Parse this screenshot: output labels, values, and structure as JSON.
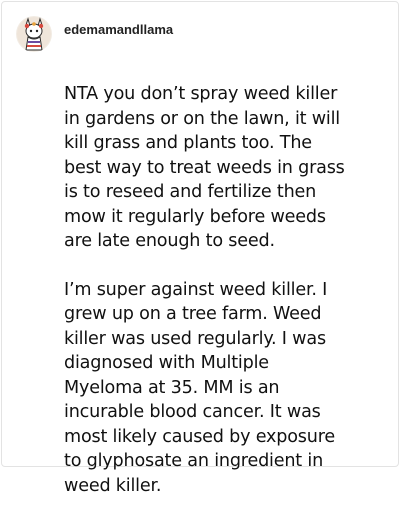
{
  "post": {
    "username": "edemamandllama",
    "avatar_icon": "llama-avatar-icon",
    "paragraphs": [
      "NTA you don’t spray weed killer\nin gardens or on the lawn, it will\nkill grass and plants too. The\nbest way to treat weeds in grass\nis to reseed and fertilize then\nmow it regularly before weeds\nare late enough to seed.",
      "I’m super against weed killer. I\ngrew up on a tree farm. Weed\nkiller was used regularly. I was\ndiagnosed with Multiple\nMyeloma at 35. MM is an\nincurable blood cancer. It was\nmost likely caused by exposure\nto glyphosate an ingredient in\nweed killer."
    ]
  }
}
